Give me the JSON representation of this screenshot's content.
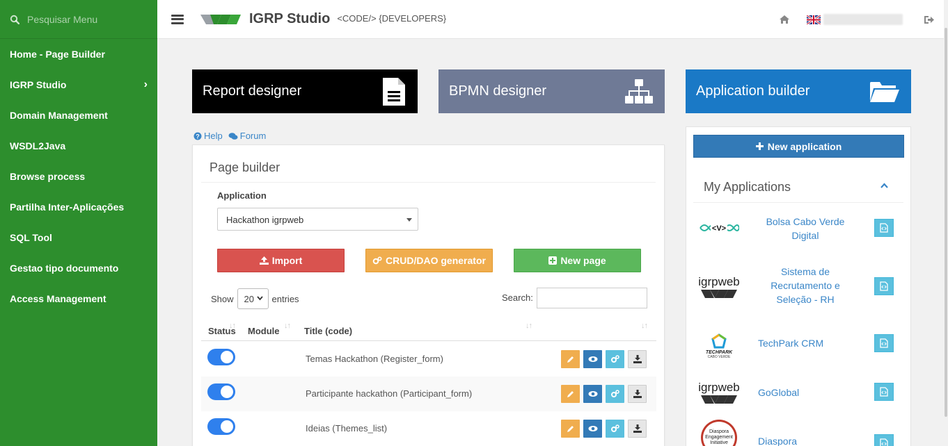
{
  "sidebar": {
    "search_placeholder": "Pesquisar Menu",
    "items": [
      {
        "label": "Home - Page Builder"
      },
      {
        "label": "IGRP Studio",
        "has_children": true
      },
      {
        "label": "Domain Management"
      },
      {
        "label": "WSDL2Java"
      },
      {
        "label": "Browse process"
      },
      {
        "label": "Partilha Inter-Aplicações"
      },
      {
        "label": "SQL Tool"
      },
      {
        "label": "Gestao tipo documento"
      },
      {
        "label": "Access Management"
      }
    ],
    "background_color": "#2d8e2d"
  },
  "header": {
    "brand": "IGRP Studio",
    "tagline": "<CODE/> {DEVELOPERS}",
    "language_flag": "uk-flag-icon"
  },
  "tiles": {
    "report": "Report designer",
    "bpmn": "BPMN designer",
    "app_builder": "Application builder"
  },
  "links": {
    "help": "Help",
    "forum": "Forum"
  },
  "page_builder": {
    "title": "Page builder",
    "application_label": "Application",
    "application_value": "Hackathon igrpweb",
    "buttons": {
      "import": "Import",
      "crud": "CRUD/DAO generator",
      "new_page": "New page"
    },
    "show_label": "Show",
    "entries_value": "20",
    "entries_label": "entries",
    "search_label": "Search:",
    "columns": {
      "status": "Status",
      "module": "Module",
      "title": "Title (code)"
    },
    "rows": [
      {
        "title": "Temas Hackathon (Register_form)",
        "status": true
      },
      {
        "title": "Participante hackathon (Participant_form)",
        "status": true
      },
      {
        "title": "Ideias (Themes_list)",
        "status": true
      }
    ]
  },
  "my_applications": {
    "new_app_label": "New application",
    "title": "My Applications",
    "apps": [
      {
        "name": "Bolsa Cabo Verde Digital",
        "logo": "vcabo-logo"
      },
      {
        "name": "Sistema de Recrutamento e Seleção - RH",
        "logo": "igrpweb-logo",
        "logo_text": "igrpweb"
      },
      {
        "name": "TechPark CRM",
        "logo": "techpark-logo",
        "logo_text": "TECHPARK",
        "logo_sub": "CABO VERDE"
      },
      {
        "name": "GoGlobal",
        "logo": "igrpweb-logo",
        "logo_text": "igrpweb"
      },
      {
        "name": "Diaspora",
        "logo": "diaspora-logo",
        "logo_text": "Diaspora Engagement Initiative"
      }
    ]
  },
  "colors": {
    "danger": "#d9534f",
    "warning": "#f0ad4e",
    "success": "#5cb85c",
    "primary": "#337ab7",
    "info": "#5bc0de",
    "app_builder": "#1a79c6",
    "bpmn": "#6f7a96"
  }
}
